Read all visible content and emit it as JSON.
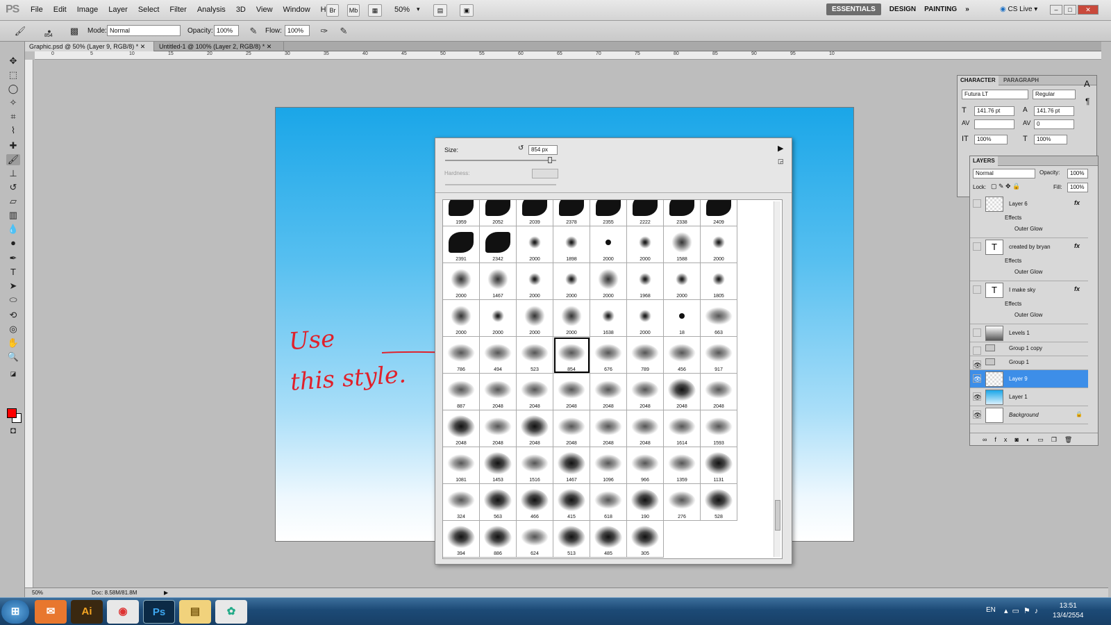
{
  "app": {
    "logo": "PS"
  },
  "menu": [
    "File",
    "Edit",
    "Image",
    "Layer",
    "Select",
    "Filter",
    "Analysis",
    "3D",
    "View",
    "Window",
    "Help"
  ],
  "menubar_minis": [
    "Br",
    "Mb"
  ],
  "zoom": "50%",
  "workspaces": {
    "essentials": "ESSENTIALS",
    "design": "DESIGN",
    "painting": "PAINTING",
    "more": "»",
    "cslive": "CS Live"
  },
  "options": {
    "brush_size": "854",
    "mode_label": "Mode:",
    "mode_value": "Normal",
    "opacity_label": "Opacity:",
    "opacity_value": "100%",
    "flow_label": "Flow:",
    "flow_value": "100%"
  },
  "tabs": [
    "Graphic.psd @ 50% (Layer 9, RGB/8) *",
    "Untitled-1 @ 100% (Layer 2, RGB/8) *"
  ],
  "ruler_ticks": [
    "0",
    "5",
    "10",
    "15",
    "20",
    "25",
    "30",
    "35",
    "40",
    "45",
    "50",
    "55",
    "60",
    "65",
    "70",
    "75",
    "80",
    "85",
    "90",
    "95",
    "10"
  ],
  "annotation": {
    "line1": "Use",
    "line2": "this style."
  },
  "picker": {
    "size_label": "Size:",
    "size_value": "854 px",
    "hardness_label": "Hardness:"
  },
  "brushes": [
    {
      "n": "1959",
      "t": "swirl"
    },
    {
      "n": "2052",
      "t": "swirl"
    },
    {
      "n": "2039",
      "t": "swirl"
    },
    {
      "n": "2378",
      "t": "swirl"
    },
    {
      "n": "2355",
      "t": "swirl"
    },
    {
      "n": "2222",
      "t": "swirl"
    },
    {
      "n": "2338",
      "t": "swirl"
    },
    {
      "n": "2409",
      "t": "swirl"
    },
    {
      "n": "2391",
      "t": "swirl"
    },
    {
      "n": "2342",
      "t": "swirl"
    },
    {
      "n": "2000",
      "t": "star"
    },
    {
      "n": "1898",
      "t": "star"
    },
    {
      "n": "2000",
      "t": "dot"
    },
    {
      "n": "2000",
      "t": "star"
    },
    {
      "n": "1588",
      "t": "soft"
    },
    {
      "n": "2000",
      "t": "star"
    },
    {
      "n": "2000",
      "t": "soft"
    },
    {
      "n": "1467",
      "t": "soft"
    },
    {
      "n": "2000",
      "t": "star"
    },
    {
      "n": "2000",
      "t": "star"
    },
    {
      "n": "2000",
      "t": "soft"
    },
    {
      "n": "1968",
      "t": "star"
    },
    {
      "n": "2000",
      "t": "star"
    },
    {
      "n": "1805",
      "t": "star"
    },
    {
      "n": "2000",
      "t": "soft"
    },
    {
      "n": "2000",
      "t": "star"
    },
    {
      "n": "2000",
      "t": "soft"
    },
    {
      "n": "2000",
      "t": "soft"
    },
    {
      "n": "1638",
      "t": "star"
    },
    {
      "n": "2000",
      "t": "star"
    },
    {
      "n": "18",
      "t": "dot"
    },
    {
      "n": "663",
      "t": "cloud"
    },
    {
      "n": "786",
      "t": "cloud"
    },
    {
      "n": "494",
      "t": "cloud"
    },
    {
      "n": "523",
      "t": "cloud"
    },
    {
      "n": "854",
      "t": "cloud",
      "sel": true
    },
    {
      "n": "676",
      "t": "cloud"
    },
    {
      "n": "789",
      "t": "cloud"
    },
    {
      "n": "456",
      "t": "cloud"
    },
    {
      "n": "917",
      "t": "cloud"
    },
    {
      "n": "887",
      "t": "cloud"
    },
    {
      "n": "2048",
      "t": "cloud"
    },
    {
      "n": "2048",
      "t": "cloud"
    },
    {
      "n": "2048",
      "t": "cloud"
    },
    {
      "n": "2048",
      "t": "cloud"
    },
    {
      "n": "2048",
      "t": "cloud"
    },
    {
      "n": "2048",
      "t": "ink"
    },
    {
      "n": "2048",
      "t": "cloud"
    },
    {
      "n": "2048",
      "t": "ink"
    },
    {
      "n": "2048",
      "t": "cloud"
    },
    {
      "n": "2048",
      "t": "ink"
    },
    {
      "n": "2048",
      "t": "cloud"
    },
    {
      "n": "2048",
      "t": "cloud"
    },
    {
      "n": "2048",
      "t": "cloud"
    },
    {
      "n": "1614",
      "t": "cloud"
    },
    {
      "n": "1593",
      "t": "cloud"
    },
    {
      "n": "1081",
      "t": "cloud"
    },
    {
      "n": "1453",
      "t": "ink"
    },
    {
      "n": "1516",
      "t": "cloud"
    },
    {
      "n": "1467",
      "t": "ink"
    },
    {
      "n": "1096",
      "t": "cloud"
    },
    {
      "n": "966",
      "t": "cloud"
    },
    {
      "n": "1359",
      "t": "cloud"
    },
    {
      "n": "1131",
      "t": "ink"
    },
    {
      "n": "324",
      "t": "cloud"
    },
    {
      "n": "563",
      "t": "ink"
    },
    {
      "n": "466",
      "t": "ink"
    },
    {
      "n": "415",
      "t": "ink"
    },
    {
      "n": "618",
      "t": "cloud"
    },
    {
      "n": "190",
      "t": "ink"
    },
    {
      "n": "276",
      "t": "cloud"
    },
    {
      "n": "528",
      "t": "ink"
    },
    {
      "n": "394",
      "t": "ink"
    },
    {
      "n": "886",
      "t": "ink"
    },
    {
      "n": "624",
      "t": "cloud"
    },
    {
      "n": "513",
      "t": "ink"
    },
    {
      "n": "485",
      "t": "ink"
    },
    {
      "n": "305",
      "t": "ink"
    }
  ],
  "character": {
    "tab1": "CHARACTER",
    "tab2": "PARAGRAPH",
    "font": "Futura LT",
    "style": "Regular",
    "size": "141.76 pt",
    "leading": "141.76 pt",
    "tracking": "0",
    "vscale": "100%",
    "hscale": "100%"
  },
  "layers": {
    "tab": "LAYERS",
    "blend": "Normal",
    "opacity_label": "Opacity:",
    "opacity": "100%",
    "lock_label": "Lock:",
    "fill_label": "Fill:",
    "fill": "100%",
    "items": [
      {
        "name": "Layer 6",
        "kind": "raster",
        "fx": true,
        "visible": false,
        "effects": "Effects",
        "glow": "Outer Glow"
      },
      {
        "name": "created by bryan",
        "kind": "text",
        "fx": true,
        "visible": false,
        "effects": "Effects",
        "glow": "Outer Glow"
      },
      {
        "name": "I make sky",
        "kind": "text",
        "fx": true,
        "visible": false,
        "effects": "Effects",
        "glow": "Outer Glow"
      },
      {
        "name": "Levels 1",
        "kind": "adjust",
        "visible": false
      },
      {
        "name": "Group 1 copy",
        "kind": "group",
        "visible": false
      },
      {
        "name": "Group 1",
        "kind": "group",
        "visible": true
      },
      {
        "name": "Layer 9",
        "kind": "raster",
        "visible": true,
        "selected": true
      },
      {
        "name": "Layer 1",
        "kind": "blue",
        "visible": true
      },
      {
        "name": "Background",
        "kind": "bg",
        "visible": true,
        "italic": true
      }
    ]
  },
  "status": {
    "zoom": "50%",
    "doc": "Doc: 8.58M/81.8M"
  },
  "taskbar": {
    "lang": "EN",
    "time": "13:51",
    "date": "13/4/2554",
    "ai": "Ai",
    "ps": "Ps"
  },
  "colors": {
    "foreground": "#ff0000",
    "background": "#ffffff",
    "annotation": "#e0212b",
    "selected_layer": "#3d8ee8"
  }
}
